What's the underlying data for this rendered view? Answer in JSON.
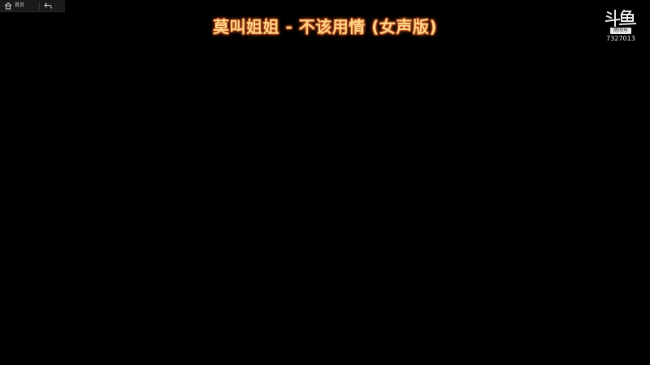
{
  "toolbar": {
    "home_label": "首页",
    "home_icon": "home-icon",
    "back_icon": "back-arrow-icon"
  },
  "title": "莫叫姐姐 - 不该用情 (女声版)",
  "watermark": {
    "logo_text": "斗鱼",
    "badge": "房间号",
    "room_number": "7327013"
  },
  "colors": {
    "background": "#000000",
    "title_fill": "#ffd587",
    "title_glow": "#c8541a"
  }
}
